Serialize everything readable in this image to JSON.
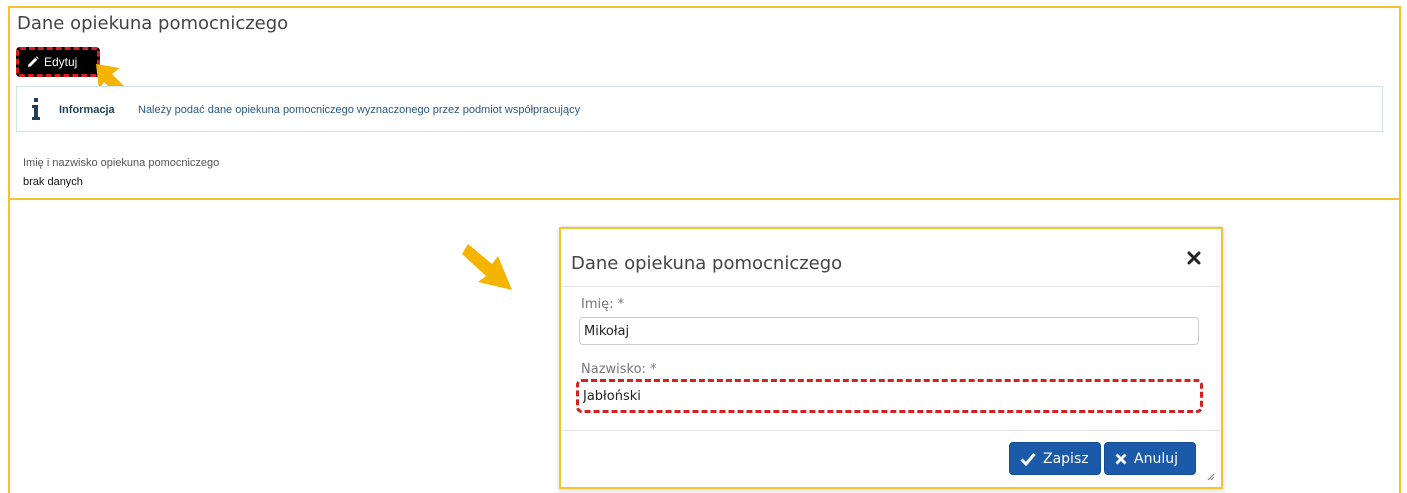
{
  "panel": {
    "title": "Dane opiekuna pomocniczego",
    "edit_label": "Edytuj",
    "info": {
      "label": "Informacja",
      "text": "Należy podać dane opiekuna pomocniczego wyznaczonego przez podmiot współpracujący"
    },
    "field": {
      "label": "Imię i nazwisko opiekuna pomocniczego",
      "value": "brak danych"
    }
  },
  "modal": {
    "title": "Dane opiekuna pomocniczego",
    "first_name": {
      "label": "Imię: *",
      "value": "Mikołaj"
    },
    "last_name": {
      "label": "Nazwisko: *",
      "value": "Jabłoński"
    },
    "save_label": "Zapisz",
    "cancel_label": "Anuluj"
  },
  "colors": {
    "accent_border": "#f3c332",
    "highlight": "#d62020",
    "primary_button": "#1a5aa8",
    "arrow": "#f5b400"
  },
  "icons": {
    "edit": "pencil-icon",
    "info": "info-icon",
    "close": "close-icon",
    "save": "check-icon",
    "cancel": "x-icon"
  }
}
